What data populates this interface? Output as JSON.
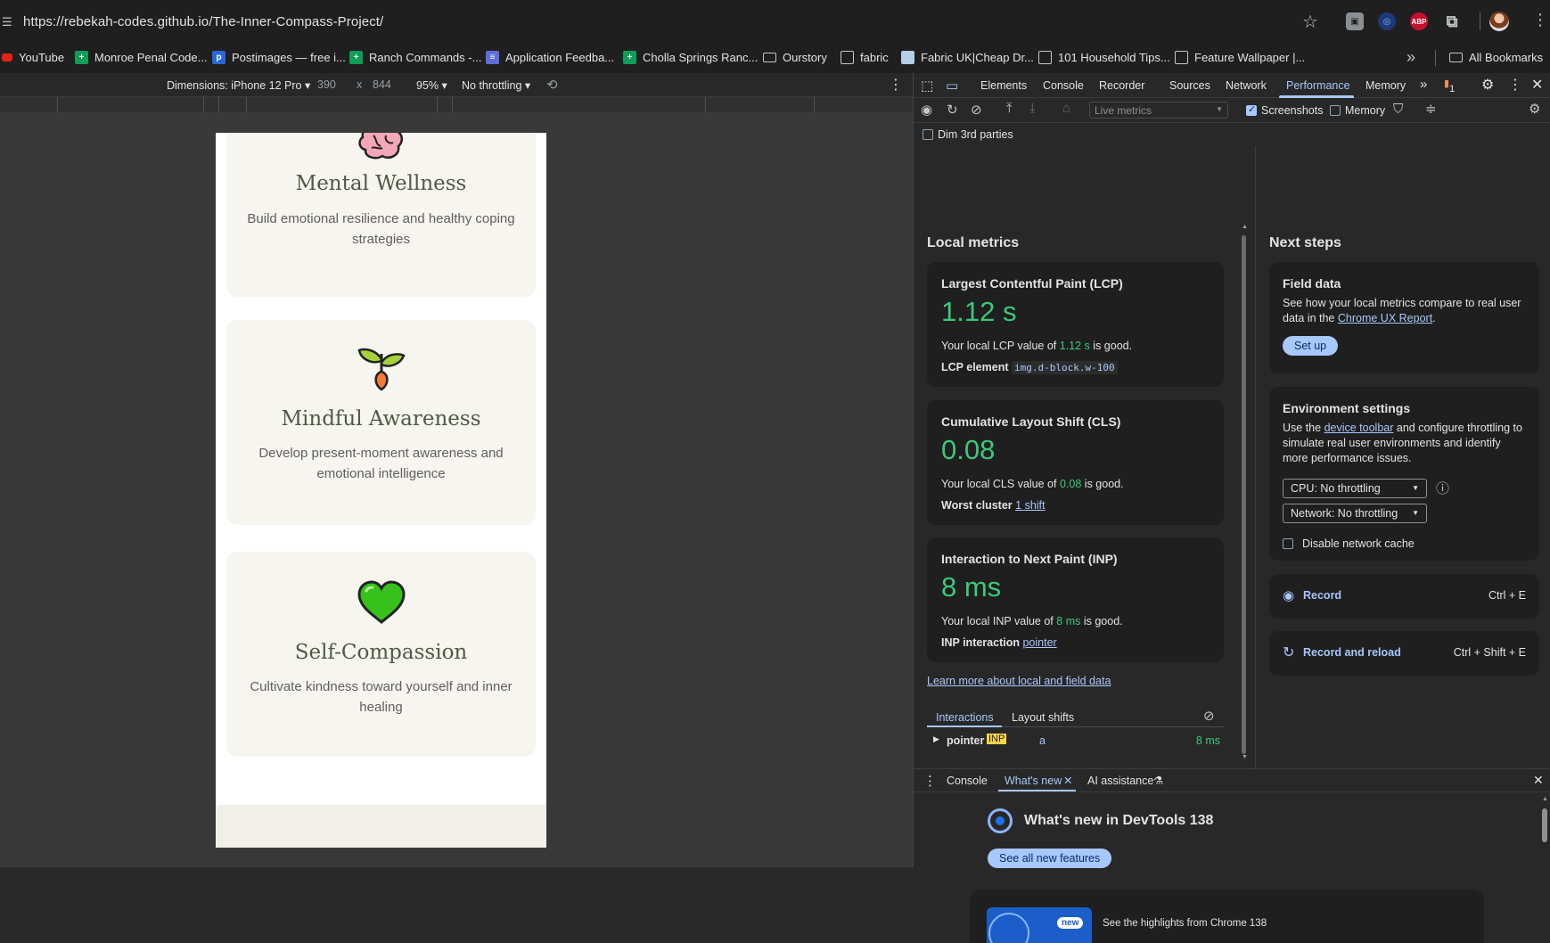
{
  "browser": {
    "url": "https://rebekah-codes.github.io/The-Inner-Compass-Project/",
    "bookmarks": [
      {
        "label": "YouTube",
        "icon": "youtube-icon"
      },
      {
        "label": "Monroe Penal Code...",
        "icon": "sheets-icon"
      },
      {
        "label": "Postimages — free i...",
        "icon": "postimages-icon"
      },
      {
        "label": "Ranch Commands -...",
        "icon": "sheets-icon"
      },
      {
        "label": "Application Feedba...",
        "icon": "forms-icon"
      },
      {
        "label": "Cholla Springs Ranc...",
        "icon": "sheets-icon"
      },
      {
        "label": "Ourstory",
        "icon": "folder-icon"
      },
      {
        "label": "fabric",
        "icon": "globe-icon"
      },
      {
        "label": "Fabric UK|Cheap Dr...",
        "icon": "image-icon"
      },
      {
        "label": "101 Household Tips...",
        "icon": "globe-icon"
      },
      {
        "label": "Feature Wallpaper |...",
        "icon": "globe-icon"
      }
    ],
    "all_bookmarks": "All Bookmarks",
    "abp_label": "ABP"
  },
  "device_toolbar": {
    "dimensions": "Dimensions: iPhone 12 Pro ▾",
    "width": "390",
    "times": "x",
    "height": "844",
    "zoom": "95% ▾",
    "throttling": "No throttling ▾"
  },
  "page": {
    "cards": [
      {
        "title": "Mental Wellness",
        "text": "Build emotional resilience and healthy coping strategies",
        "icon": "brain-icon"
      },
      {
        "title": "Mindful Awareness",
        "text": "Develop present-moment awareness and emotional intelligence",
        "icon": "sprout-icon"
      },
      {
        "title": "Self-Compassion",
        "text": "Cultivate kindness toward yourself and inner healing",
        "icon": "green-heart-icon"
      }
    ]
  },
  "devtools": {
    "tabs": [
      "Elements",
      "Console",
      "Recorder",
      "Sources",
      "Network",
      "Performance",
      "Memory"
    ],
    "active_tab": "Performance",
    "issues_count": "1",
    "live_metrics": "Live metrics",
    "screenshots_label": "Screenshots",
    "memory_label": "Memory",
    "dim_third_parties": "Dim 3rd parties",
    "local_metrics": {
      "heading": "Local metrics",
      "lcp": {
        "title": "Largest Contentful Paint (LCP)",
        "value": "1.12 s",
        "desc_pre": "Your local LCP value of",
        "desc_val": "1.12 s",
        "desc_post": "is good.",
        "elem_label": "LCP element",
        "elem_value": "img.d-block.w-100"
      },
      "cls": {
        "title": "Cumulative Layout Shift (CLS)",
        "value": "0.08",
        "desc_pre": "Your local CLS value of",
        "desc_val": "0.08",
        "desc_post": "is good.",
        "elem_label": "Worst cluster",
        "elem_value": "1 shift"
      },
      "inp": {
        "title": "Interaction to Next Paint (INP)",
        "value": "8 ms",
        "desc_pre": "Your local INP value of",
        "desc_val": "8 ms",
        "desc_post": "is good.",
        "elem_label": "INP interaction",
        "elem_value": "pointer"
      },
      "learn_more": "Learn more about local and field data",
      "subtabs": [
        "Interactions",
        "Layout shifts"
      ],
      "interaction_row": {
        "type": "pointer",
        "badge": "INP",
        "target": "a",
        "duration": "8 ms"
      }
    },
    "next_steps": {
      "heading": "Next steps",
      "field_data": {
        "title": "Field data",
        "text_pre": "See how your local metrics compare to real user data in the",
        "link": "Chrome UX Report",
        "text_post": ".",
        "button": "Set up"
      },
      "env": {
        "title": "Environment settings",
        "text_pre": "Use the",
        "link": "device toolbar",
        "text_post": "and configure throttling to simulate real user environments and identify more performance issues.",
        "cpu": "CPU: No throttling",
        "network": "Network: No throttling",
        "disable_cache": "Disable network cache"
      },
      "record": {
        "label": "Record",
        "shortcut": "Ctrl + E"
      },
      "record_reload": {
        "label": "Record and reload",
        "shortcut": "Ctrl + Shift + E"
      }
    },
    "drawer": {
      "tabs": [
        "Console",
        "What's new",
        "AI assistance"
      ],
      "active_tab": "What's new",
      "title": "What's new in DevTools 138",
      "button": "See all new features",
      "new_badge": "new",
      "highlight": "See the highlights from Chrome 138"
    }
  }
}
